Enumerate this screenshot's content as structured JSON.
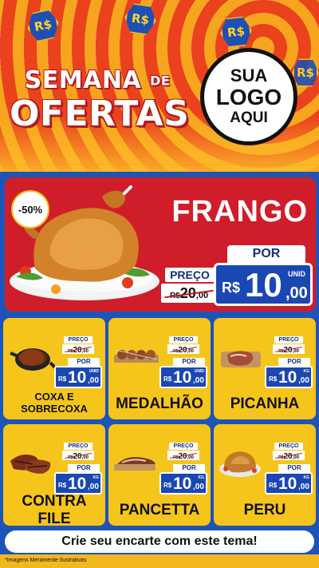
{
  "header": {
    "title_line1": "SEMANA",
    "title_de": "DE",
    "title_line2": "OFERTAS",
    "coin_symbol": "R$",
    "logo_line1": "SUA",
    "logo_line2": "LOGO",
    "logo_line3": "AQUI"
  },
  "feature": {
    "discount": "-50%",
    "product": "FRANGO",
    "preco_label": "PREÇO",
    "old_currency": "R$",
    "old_value": "20",
    "old_cents": ",00",
    "por_label": "POR",
    "new_currency": "R$",
    "new_value": "10",
    "new_cents": ",00",
    "unit": "UNID"
  },
  "products": [
    {
      "name": "COXA E SOBRECOXA",
      "preco_label": "PREÇO",
      "old_currency": "R$",
      "old_value": "20",
      "old_cents": ",00",
      "por_label": "POR",
      "new_currency": "R$",
      "new_value": "10",
      "new_cents": ",00",
      "unit": "UNID"
    },
    {
      "name": "MEDALHÃO",
      "preco_label": "PREÇO",
      "old_currency": "R$",
      "old_value": "20",
      "old_cents": ",00",
      "por_label": "POR",
      "new_currency": "R$",
      "new_value": "10",
      "new_cents": ",00",
      "unit": "UNID"
    },
    {
      "name": "PICANHA",
      "preco_label": "PREÇO",
      "old_currency": "R$",
      "old_value": "20",
      "old_cents": ",00",
      "por_label": "POR",
      "new_currency": "R$",
      "new_value": "10",
      "new_cents": ",00",
      "unit": "KG"
    },
    {
      "name": "CONTRA FILE",
      "preco_label": "PREÇO",
      "old_currency": "R$",
      "old_value": "20",
      "old_cents": ",00",
      "por_label": "POR",
      "new_currency": "R$",
      "new_value": "10",
      "new_cents": ",00",
      "unit": "KG"
    },
    {
      "name": "PANCETTA",
      "preco_label": "PREÇO",
      "old_currency": "R$",
      "old_value": "20",
      "old_cents": ",00",
      "por_label": "POR",
      "new_currency": "R$",
      "new_value": "10",
      "new_cents": ",00",
      "unit": "KG"
    },
    {
      "name": "PERU",
      "preco_label": "PREÇO",
      "old_currency": "R$",
      "old_value": "20",
      "old_cents": ",00",
      "por_label": "POR",
      "new_currency": "R$",
      "new_value": "10",
      "new_cents": ",00",
      "unit": "KG"
    }
  ],
  "cta": "Crie seu encarte com este tema!",
  "footer_note": "*Imagens Meramente Ilustrativas",
  "colors": {
    "red": "#cf1e2a",
    "blue": "#1b47b3",
    "yellow": "#f6c51c",
    "orange": "#f7a51e"
  }
}
